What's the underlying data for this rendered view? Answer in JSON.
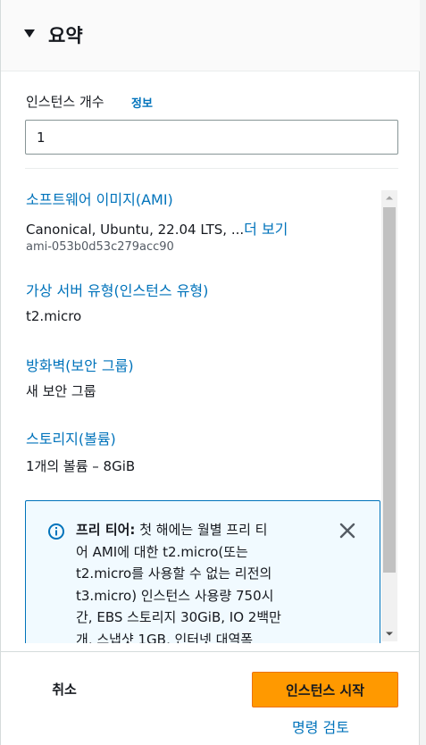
{
  "summary": {
    "title": "요약",
    "caret_icon": "caret-down-icon",
    "instance_count": {
      "label": "인스턴스 개수",
      "info_link": "정보",
      "value": "1"
    },
    "sections": {
      "ami": {
        "title": "소프트웨어 이미지(AMI)",
        "value": "Canonical, Ubuntu, 22.04 LTS, ...",
        "more_link": "더 보기",
        "ami_id": "ami-053b0d53c279acc90"
      },
      "instance_type": {
        "title": "가상 서버 유형(인스턴스 유형)",
        "value": "t2.micro"
      },
      "firewall": {
        "title": "방화벽(보안 그룹)",
        "value": "새 보안 그룹"
      },
      "storage": {
        "title": "스토리지(볼륨)",
        "value": "1개의 볼륨 – 8GiB"
      }
    },
    "free_tier": {
      "icon": "info-icon",
      "bold_label": "프리 티어:",
      "lines": [
        "첫 해에는 월별 프리 티",
        "어 AMI에 대한 t2.micro(또는",
        "t2.micro를 사용할 수 없는 리전의",
        "t3.micro) 인스턴스 사용량 750시",
        "간, EBS 스토리지 30GiB, IO 2백만",
        "개, 스냅샷 1GB, 인터넷 대역폭"
      ],
      "close_icon": "close-icon"
    }
  },
  "footer": {
    "cancel_label": "취소",
    "launch_label": "인스턴스 시작",
    "review_label": "명령 검토"
  },
  "colors": {
    "link": "#0073bb",
    "primary_button": "#ff9900",
    "info_border": "#0073bb",
    "info_background": "#f1faff",
    "text": "#16191f"
  }
}
